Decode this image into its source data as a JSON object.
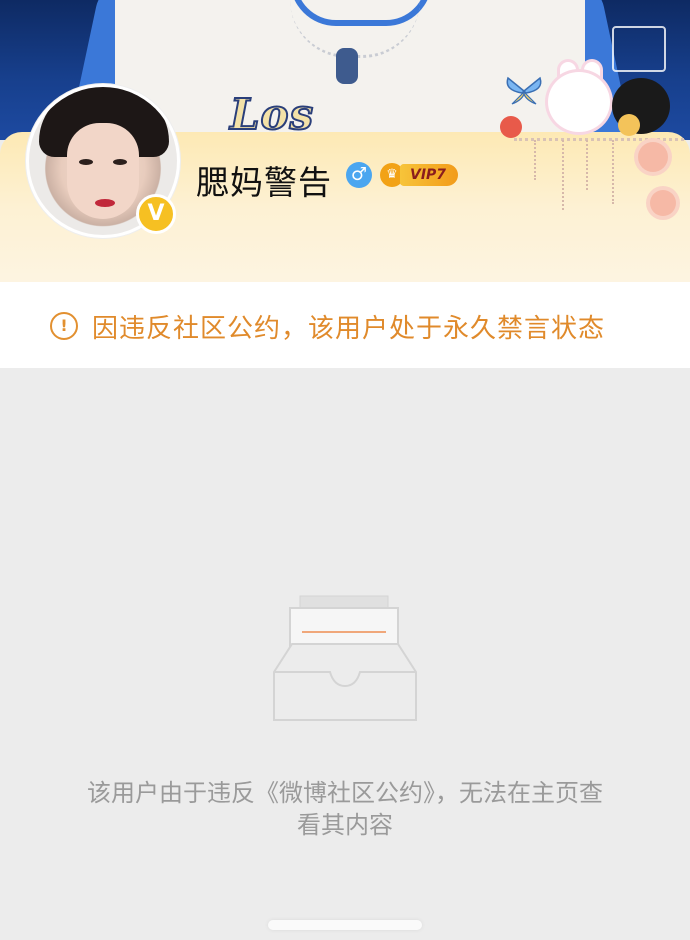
{
  "cover": {
    "brand_text": "Los Angeles"
  },
  "profile": {
    "username": "腮妈警告",
    "gender_icon": "male-icon",
    "gender_symbol": "♂",
    "verified_badge": "V",
    "vip_level": "VIP7",
    "colors": {
      "verified": "#f6c022",
      "gender": "#4ba6f0",
      "vip": "#f29b1a"
    }
  },
  "notice": {
    "icon": "warning-circle-icon",
    "icon_symbol": "!",
    "text": "因违反社区公约，该用户处于永久禁言状态",
    "color": "#e08a2b"
  },
  "empty_state": {
    "icon": "empty-inbox-icon",
    "message": "该用户由于违反《微博社区公约》，无法在主页查看其内容"
  }
}
